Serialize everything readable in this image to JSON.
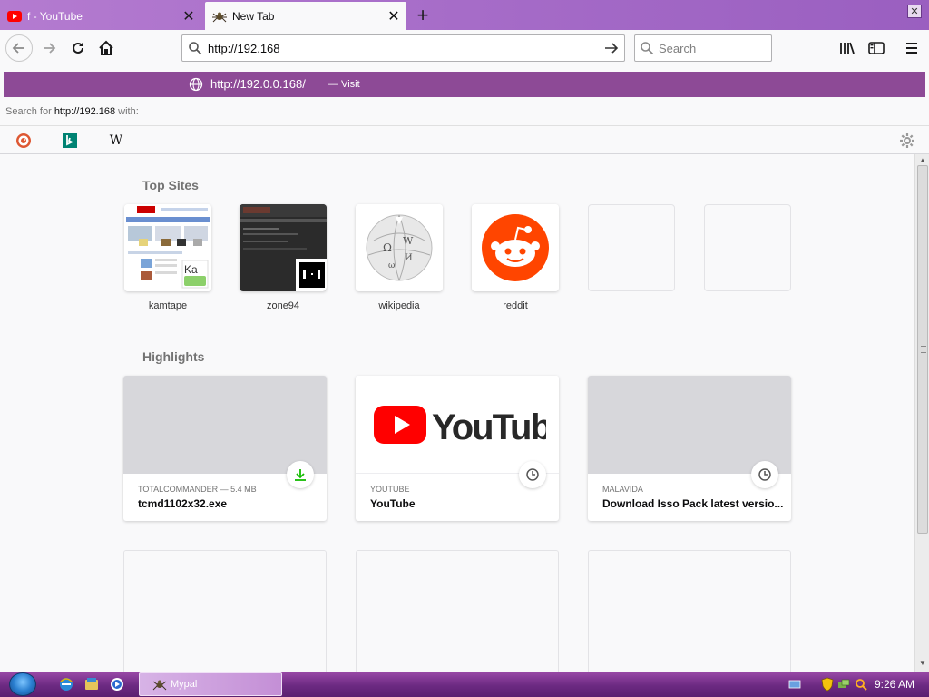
{
  "tabs": [
    {
      "title": "f - YouTube",
      "favicon": "youtube-icon",
      "active": false
    },
    {
      "title": "New Tab",
      "favicon": "spider-icon",
      "active": true
    }
  ],
  "navbar": {
    "url_value": "http://192.168",
    "search_placeholder": "Search"
  },
  "dropdown": {
    "suggestion_url": "http://192.0.0.168/",
    "suggestion_action": "— Visit",
    "search_for_prefix": "Search for",
    "search_for_query": "http://192.168",
    "search_for_suffix": "with:",
    "engines": [
      "duckduckgo-icon",
      "bing-icon",
      "wikipedia-icon"
    ]
  },
  "top_sites": {
    "heading": "Top Sites",
    "items": [
      {
        "label": "kamtape"
      },
      {
        "label": "zone94"
      },
      {
        "label": "wikipedia"
      },
      {
        "label": "reddit"
      },
      {
        "label": ""
      },
      {
        "label": ""
      }
    ]
  },
  "highlights": {
    "heading": "Highlights",
    "items": [
      {
        "meta": "TOTALCOMMANDER — 5.4 MB",
        "title": "tcmd1102x32.exe",
        "badge": "download-icon"
      },
      {
        "meta": "YOUTUBE",
        "title": "YouTube",
        "badge": "clock-icon",
        "logo_text": "YouTube"
      },
      {
        "meta": "MALAVIDA",
        "title": "Download Isso Pack latest versio...",
        "badge": "clock-icon"
      }
    ]
  },
  "taskbar": {
    "task_label": "Mypal",
    "clock": "9:26 AM"
  },
  "colors": {
    "tabstrip": "#a66cc8",
    "suggestion_highlight": "#8d4a96",
    "taskbar": "#6c2a82",
    "reddit": "#ff4500",
    "youtube_red": "#ff0000"
  }
}
